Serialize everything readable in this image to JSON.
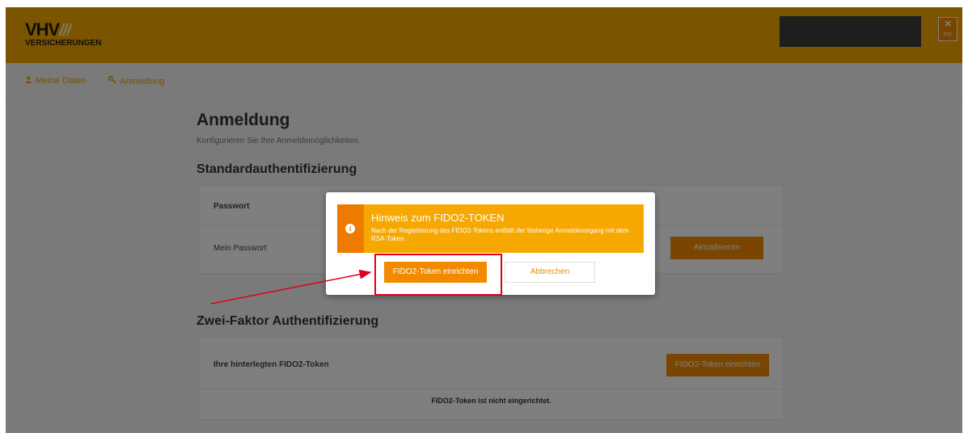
{
  "header": {
    "logo_main": "VHV",
    "logo_slashes": "///",
    "logo_sub": "VERSICHERUNGEN",
    "close_symbol": "×",
    "close_label": "esc"
  },
  "nav": {
    "items": [
      {
        "label": "Meine Daten",
        "icon": "user-icon"
      },
      {
        "label": "Anmeldung",
        "icon": "key-icon"
      }
    ]
  },
  "main": {
    "title": "Anmeldung",
    "subtitle": "Konfigurieren Sie Ihre Anmeldemöglichkeiten.",
    "standard_section": {
      "title": "Standardauthentifizierung",
      "header_label": "Passwort",
      "row_label": "Mein Passwort",
      "button_label": "Aktualisieren"
    },
    "twofactor_section": {
      "title": "Zwei-Faktor Authentifizierung",
      "header_label": "Ihre hinterlegten FIDO2-Token",
      "button_label": "FIDO2-Token einrichten",
      "empty_text": "FIDO2-Token ist nicht eingerichtet."
    }
  },
  "modal": {
    "alert_icon": "info-icon",
    "alert_title": "Hinweis zum FIDO2-TOKEN",
    "alert_text": "Nach der Registrierung des FIDO2-Tokens entfällt der bisherige Anmeldevorgang mit dem RSA-Token.",
    "setup_button": "FIDO2-Token einrichten",
    "cancel_button": "Abbrechen"
  },
  "colors": {
    "brand": "#f6a800",
    "accent": "#f28a00",
    "annotation": "#e0001b"
  }
}
